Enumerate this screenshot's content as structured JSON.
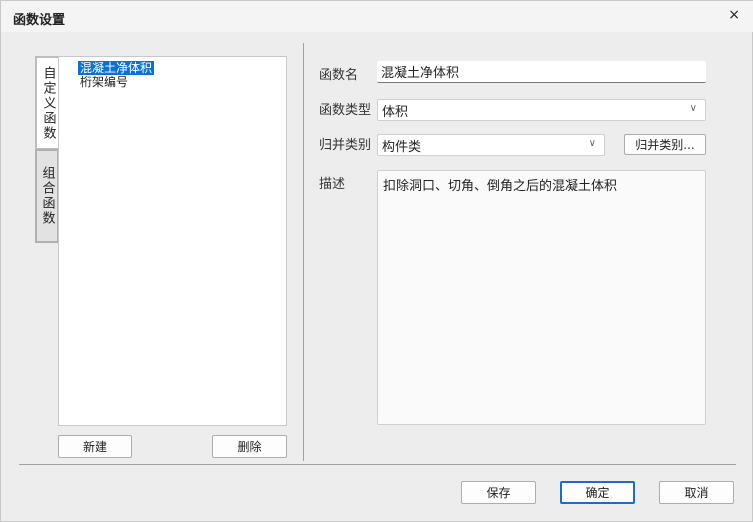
{
  "window": {
    "title": "函数设置",
    "close": "×"
  },
  "tabs": [
    {
      "label": "自定义函数"
    },
    {
      "label": "组合函数"
    }
  ],
  "functions": [
    {
      "label": "混凝土净体积"
    },
    {
      "label": "桁架编号"
    }
  ],
  "left_buttons": {
    "new": "新建",
    "delete": "删除"
  },
  "form": {
    "name_label": "函数名",
    "name_value": "混凝土净体积",
    "type_label": "函数类型",
    "type_value": "体积",
    "category_label": "归并类别",
    "category_value": "构件类",
    "category_button": "归并类别...",
    "desc_label": "描述",
    "desc_value": "扣除洞口、切角、倒角之后的混凝土体积"
  },
  "footer": {
    "save": "保存",
    "ok": "确定",
    "cancel": "取消"
  }
}
